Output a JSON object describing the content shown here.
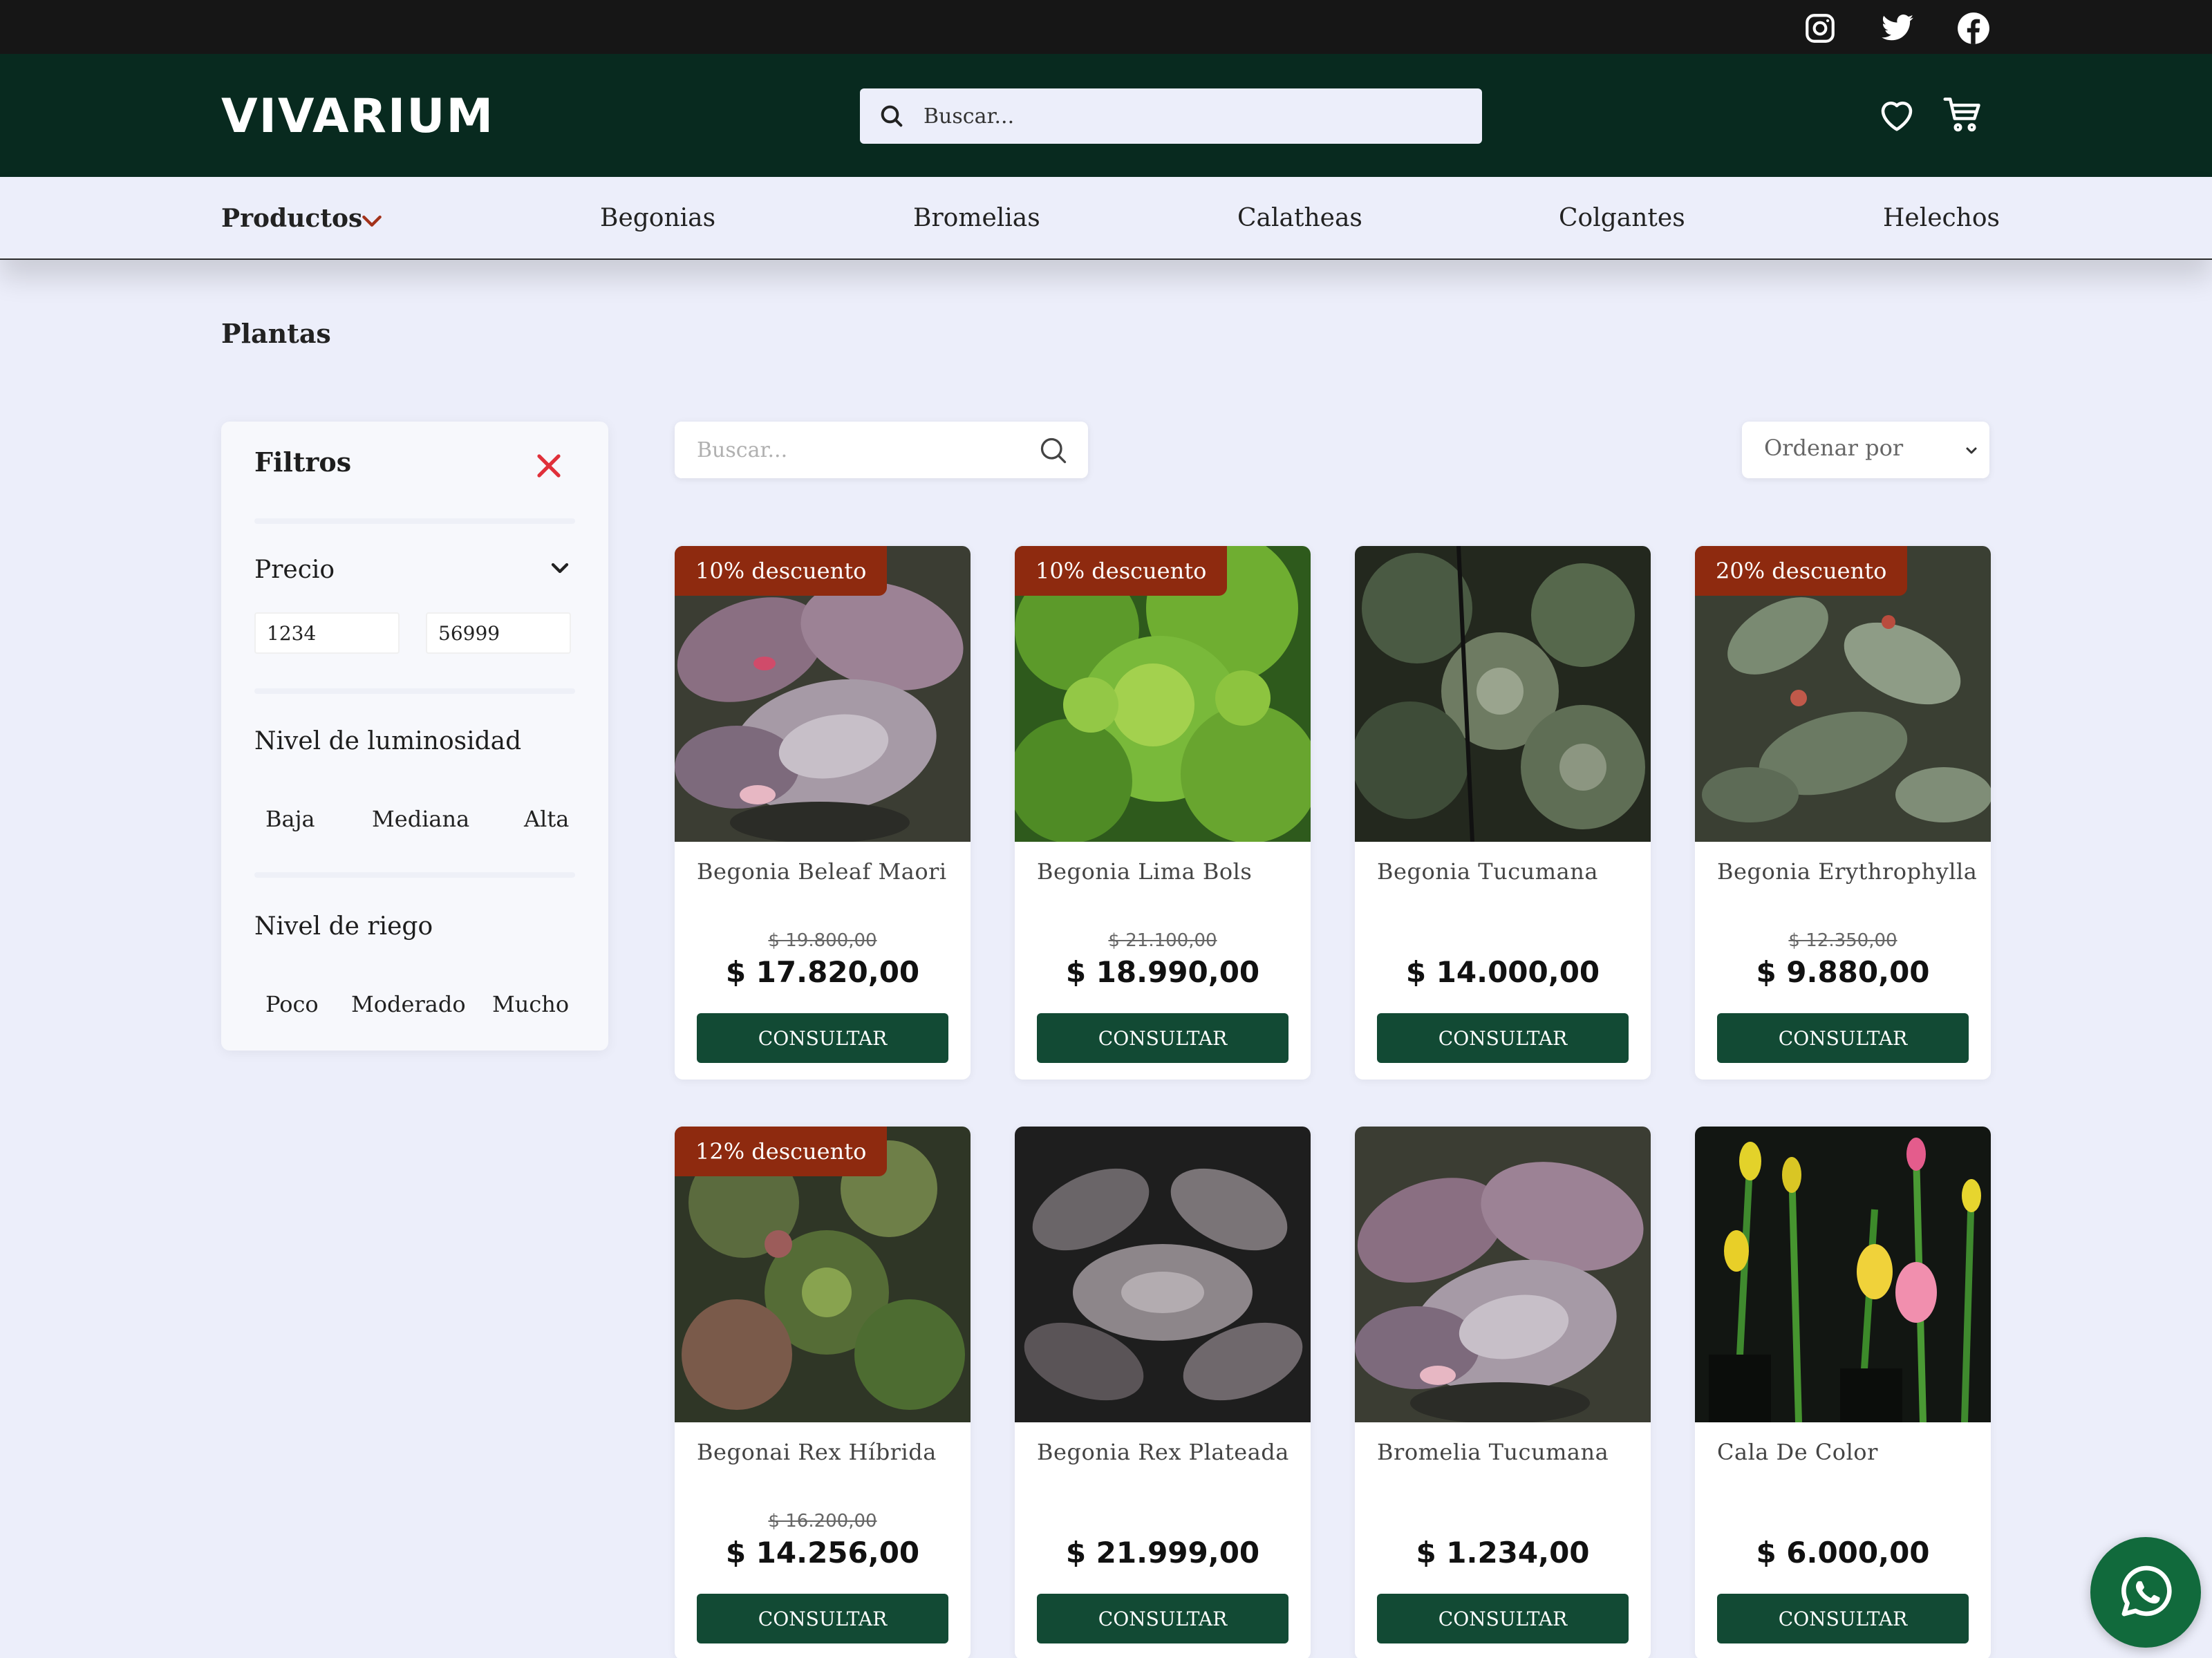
{
  "brand": {
    "name": "VIVARIUM"
  },
  "header": {
    "search_placeholder": "Buscar..."
  },
  "social_icons": [
    "instagram-icon",
    "twitter-icon",
    "facebook-icon"
  ],
  "nav": {
    "products": "Productos",
    "items": [
      "Begonias",
      "Bromelias",
      "Calatheas",
      "Colgantes",
      "Helechos"
    ]
  },
  "breadcrumb": "Plantas",
  "filters": {
    "title": "Filtros",
    "price": {
      "title": "Precio",
      "min": "1234",
      "max": "56999"
    },
    "light": {
      "title": "Nivel de luminosidad",
      "options": [
        "Baja",
        "Mediana",
        "Alta"
      ]
    },
    "water": {
      "title": "Nivel de riego",
      "options": [
        "Poco",
        "Moderado",
        "Mucho"
      ]
    }
  },
  "toolbar": {
    "search_placeholder": "Buscar...",
    "sort_label": "Ordenar por"
  },
  "colors": {
    "topbar": "#161616",
    "header": "#082a1f",
    "badge": "#8e2a0f",
    "button": "#124a34",
    "whatsapp": "#116a3c"
  },
  "products": [
    {
      "name": "Begonia Beleaf Maori",
      "badge": "10% descuento",
      "old_price": "$ 19.800,00",
      "price": "$ 17.820,00",
      "button": "CONSULTAR"
    },
    {
      "name": "Begonia Lima Bols",
      "badge": "10% descuento",
      "old_price": "$ 21.100,00",
      "price": "$ 18.990,00",
      "button": "CONSULTAR"
    },
    {
      "name": "Begonia Tucumana",
      "badge": "",
      "old_price": "",
      "price": "$ 14.000,00",
      "button": "CONSULTAR"
    },
    {
      "name": "Begonia Erythrophylla",
      "badge": "20% descuento",
      "old_price": "$ 12.350,00",
      "price": "$ 9.880,00",
      "button": "CONSULTAR"
    },
    {
      "name": "Begonai Rex Híbrida",
      "badge": "12% descuento",
      "old_price": "$ 16.200,00",
      "price": "$ 14.256,00",
      "button": "CONSULTAR"
    },
    {
      "name": "Begonia Rex Plateada",
      "badge": "",
      "old_price": "",
      "price": "$ 21.999,00",
      "button": "CONSULTAR"
    },
    {
      "name": "Bromelia Tucumana",
      "badge": "",
      "old_price": "",
      "price": "$ 1.234,00",
      "button": "CONSULTAR"
    },
    {
      "name": "Cala De Color",
      "badge": "",
      "old_price": "",
      "price": "$ 6.000,00",
      "button": "CONSULTAR"
    }
  ]
}
